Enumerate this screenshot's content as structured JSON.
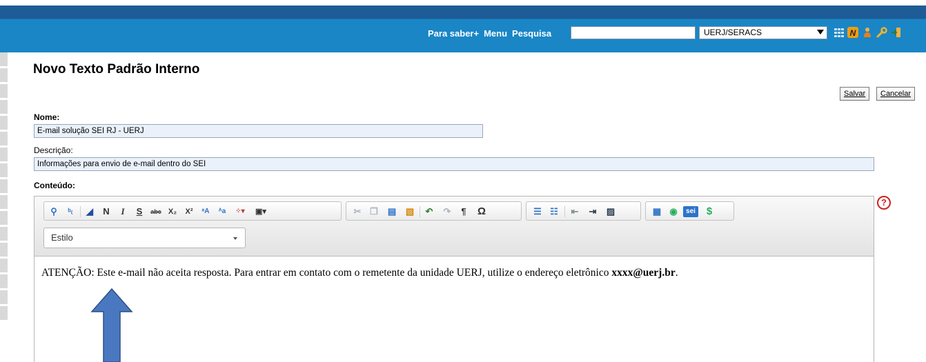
{
  "header": {
    "nav": [
      "Para saber+",
      "Menu",
      "Pesquisa"
    ],
    "search_value": "",
    "unit_selected": "UERJ/SERACS",
    "icons": [
      "grid-icon",
      "n-icon",
      "user-icon",
      "wrench-icon",
      "exit-icon"
    ]
  },
  "page": {
    "title": "Novo Texto Padrão Interno",
    "save_label": "Salvar",
    "cancel_label": "Cancelar"
  },
  "form": {
    "name_label": "Nome:",
    "name_value": "E-mail solução SEI RJ - UERJ",
    "description_label": "Descrição:",
    "description_value": "Informações para envio de e-mail  dentro do SEI",
    "content_label": "Conteúdo:",
    "help_glyph": "?"
  },
  "editor": {
    "style_placeholder": "Estilo",
    "toolbar_letters": {
      "bold": "N",
      "italic": "I",
      "strike": "S",
      "omega": "Ω",
      "dollar": "$",
      "sei": "sei",
      "pilcrow": "¶"
    },
    "content_text": "ATENÇÃO: Este e-mail não aceita resposta. Para entrar em contato com o remetente da unidade UERJ, utilize o endereço eletrônico ",
    "content_email": "xxxx@uerj.br",
    "content_end": "."
  },
  "colors": {
    "header_top": "#1e5c97",
    "header_bar": "#1a86c6",
    "field_bg": "#eaf1fb",
    "help_red": "#d02020",
    "arrow_fill": "#4a78c0"
  }
}
